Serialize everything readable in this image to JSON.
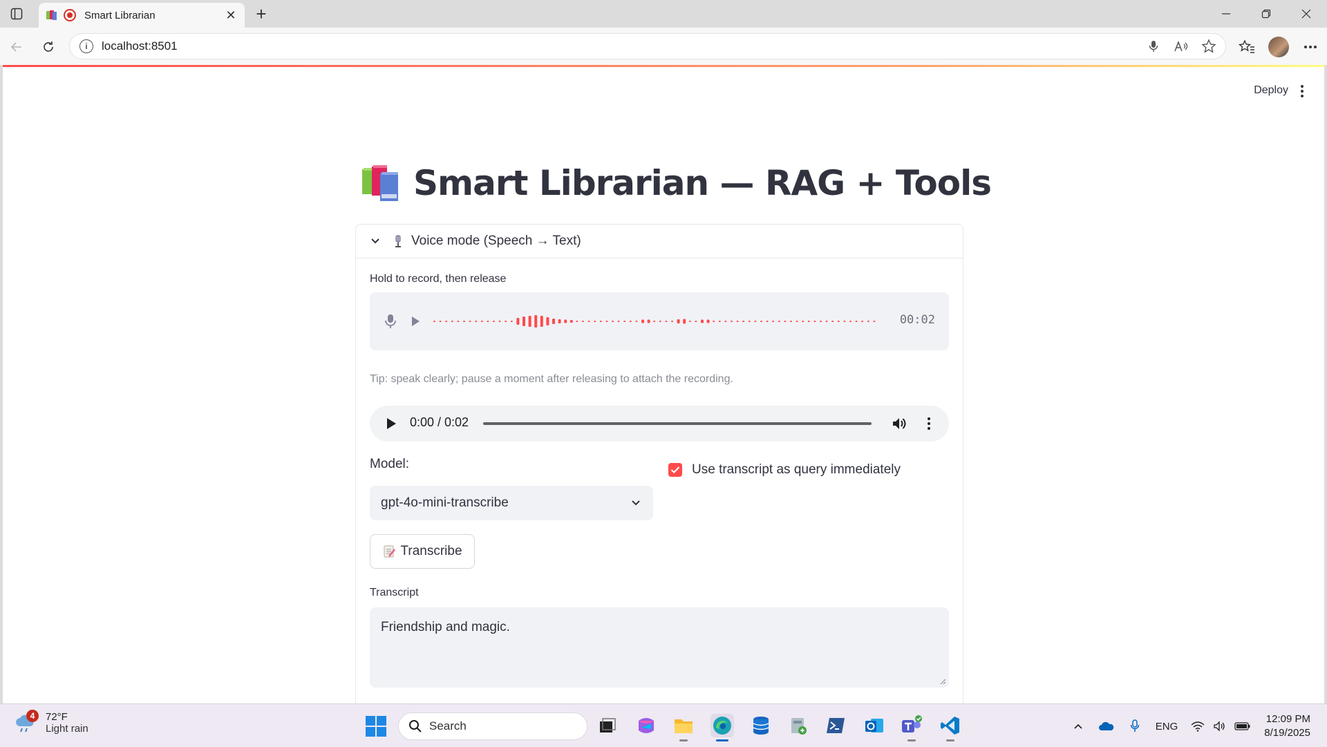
{
  "browser": {
    "tab_title": "Smart Librarian",
    "url": "localhost:8501"
  },
  "app": {
    "deploy_label": "Deploy",
    "title": "Smart Librarian — RAG + Tools",
    "voice_expander": {
      "label": "Voice mode (Speech → Text)",
      "expanded": true,
      "recorder_label": "Hold to record, then release",
      "recording_time": "00:02",
      "tip": "Tip: speak clearly; pause a moment after releasing to attach the recording.",
      "audio_player": {
        "time": "0:00 / 0:02",
        "progress": 0
      },
      "model_label": "Model:",
      "model_value": "gpt-4o-mini-transcribe",
      "checkbox_label": "Use transcript as query immediately",
      "checkbox_checked": true,
      "transcribe_button": "Transcribe",
      "transcript_label": "Transcript",
      "transcript_value": "Friendship and magic."
    }
  },
  "colors": {
    "accent": "#ff4b4b",
    "text": "#31333f",
    "widget_bg": "#f0f2f6"
  },
  "taskbar": {
    "weather_badge": "4",
    "weather_temp": "72°F",
    "weather_desc": "Light rain",
    "search_label": "Search",
    "language": "ENG",
    "time": "12:09 PM",
    "date": "8/19/2025"
  }
}
